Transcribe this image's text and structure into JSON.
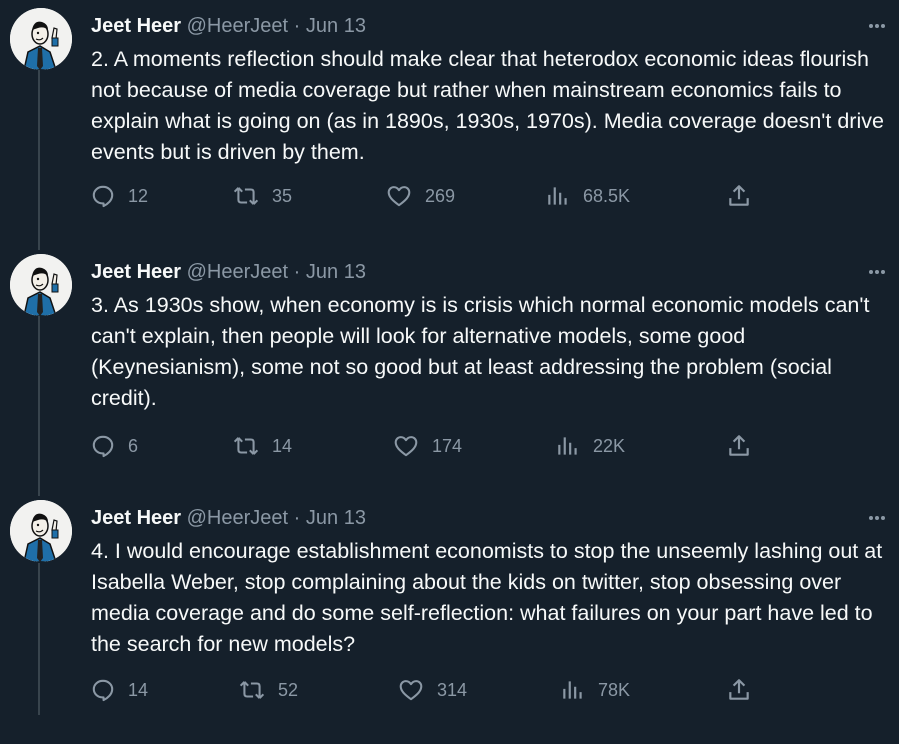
{
  "tweets": [
    {
      "name": "Jeet Heer",
      "handle": "@HeerJeet",
      "separator": "·",
      "date": "Jun 13",
      "text": "2. A moments reflection should make clear that heterodox economic ideas flourish not because of media coverage but rather when mainstream economics fails to explain what is going on (as in 1890s, 1930s, 1970s). Media coverage doesn't drive events but is driven by them.",
      "replies": "12",
      "reposts": "35",
      "likes": "269",
      "views": "68.5K"
    },
    {
      "name": "Jeet Heer",
      "handle": "@HeerJeet",
      "separator": "·",
      "date": "Jun 13",
      "text": "3. As 1930s show, when economy is is crisis which normal economic models can't can't explain, then people will look for alternative models, some good (Keynesianism), some not so good but at least addressing the problem (social credit).",
      "replies": "6",
      "reposts": "14",
      "likes": "174",
      "views": "22K"
    },
    {
      "name": "Jeet Heer",
      "handle": "@HeerJeet",
      "separator": "·",
      "date": "Jun 13",
      "text": "4. I would encourage establishment economists to stop the unseemly lashing out at Isabella Weber, stop complaining about the kids on twitter, stop obsessing over media coverage and do some self-reflection: what failures on your part have led to the search for new models?",
      "replies": "14",
      "reposts": "52",
      "likes": "314",
      "views": "78K"
    }
  ],
  "colors": {
    "background": "#15202b",
    "primary_text": "#f7f9f9",
    "secondary_text": "#8b98a5",
    "thread_line": "#38444d"
  },
  "icons": [
    "reply-icon",
    "repost-icon",
    "like-icon",
    "views-icon",
    "share-icon",
    "more-icon"
  ]
}
